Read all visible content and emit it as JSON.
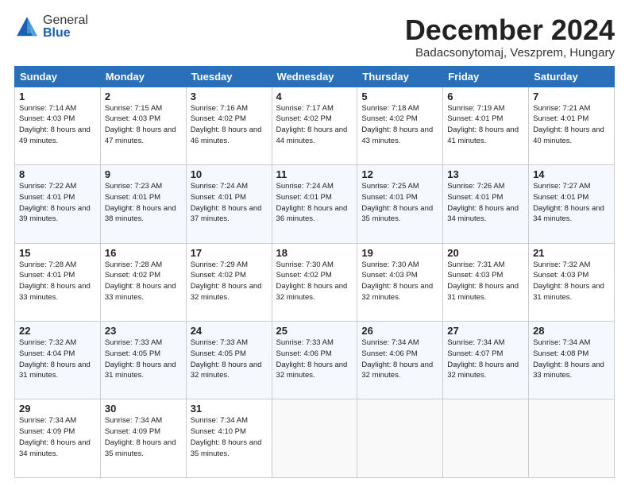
{
  "logo": {
    "general": "General",
    "blue": "Blue"
  },
  "title": "December 2024",
  "location": "Badacsonytomaj, Veszprem, Hungary",
  "days_of_week": [
    "Sunday",
    "Monday",
    "Tuesday",
    "Wednesday",
    "Thursday",
    "Friday",
    "Saturday"
  ],
  "weeks": [
    [
      {
        "day": 1,
        "sunrise": "7:14 AM",
        "sunset": "4:03 PM",
        "daylight": "8 hours and 49 minutes."
      },
      {
        "day": 2,
        "sunrise": "7:15 AM",
        "sunset": "4:03 PM",
        "daylight": "8 hours and 47 minutes."
      },
      {
        "day": 3,
        "sunrise": "7:16 AM",
        "sunset": "4:02 PM",
        "daylight": "8 hours and 46 minutes."
      },
      {
        "day": 4,
        "sunrise": "7:17 AM",
        "sunset": "4:02 PM",
        "daylight": "8 hours and 44 minutes."
      },
      {
        "day": 5,
        "sunrise": "7:18 AM",
        "sunset": "4:02 PM",
        "daylight": "8 hours and 43 minutes."
      },
      {
        "day": 6,
        "sunrise": "7:19 AM",
        "sunset": "4:01 PM",
        "daylight": "8 hours and 41 minutes."
      },
      {
        "day": 7,
        "sunrise": "7:21 AM",
        "sunset": "4:01 PM",
        "daylight": "8 hours and 40 minutes."
      }
    ],
    [
      {
        "day": 8,
        "sunrise": "7:22 AM",
        "sunset": "4:01 PM",
        "daylight": "8 hours and 39 minutes."
      },
      {
        "day": 9,
        "sunrise": "7:23 AM",
        "sunset": "4:01 PM",
        "daylight": "8 hours and 38 minutes."
      },
      {
        "day": 10,
        "sunrise": "7:24 AM",
        "sunset": "4:01 PM",
        "daylight": "8 hours and 37 minutes."
      },
      {
        "day": 11,
        "sunrise": "7:24 AM",
        "sunset": "4:01 PM",
        "daylight": "8 hours and 36 minutes."
      },
      {
        "day": 12,
        "sunrise": "7:25 AM",
        "sunset": "4:01 PM",
        "daylight": "8 hours and 35 minutes."
      },
      {
        "day": 13,
        "sunrise": "7:26 AM",
        "sunset": "4:01 PM",
        "daylight": "8 hours and 34 minutes."
      },
      {
        "day": 14,
        "sunrise": "7:27 AM",
        "sunset": "4:01 PM",
        "daylight": "8 hours and 34 minutes."
      }
    ],
    [
      {
        "day": 15,
        "sunrise": "7:28 AM",
        "sunset": "4:01 PM",
        "daylight": "8 hours and 33 minutes."
      },
      {
        "day": 16,
        "sunrise": "7:28 AM",
        "sunset": "4:02 PM",
        "daylight": "8 hours and 33 minutes."
      },
      {
        "day": 17,
        "sunrise": "7:29 AM",
        "sunset": "4:02 PM",
        "daylight": "8 hours and 32 minutes."
      },
      {
        "day": 18,
        "sunrise": "7:30 AM",
        "sunset": "4:02 PM",
        "daylight": "8 hours and 32 minutes."
      },
      {
        "day": 19,
        "sunrise": "7:30 AM",
        "sunset": "4:03 PM",
        "daylight": "8 hours and 32 minutes."
      },
      {
        "day": 20,
        "sunrise": "7:31 AM",
        "sunset": "4:03 PM",
        "daylight": "8 hours and 31 minutes."
      },
      {
        "day": 21,
        "sunrise": "7:32 AM",
        "sunset": "4:03 PM",
        "daylight": "8 hours and 31 minutes."
      }
    ],
    [
      {
        "day": 22,
        "sunrise": "7:32 AM",
        "sunset": "4:04 PM",
        "daylight": "8 hours and 31 minutes."
      },
      {
        "day": 23,
        "sunrise": "7:33 AM",
        "sunset": "4:05 PM",
        "daylight": "8 hours and 31 minutes."
      },
      {
        "day": 24,
        "sunrise": "7:33 AM",
        "sunset": "4:05 PM",
        "daylight": "8 hours and 32 minutes."
      },
      {
        "day": 25,
        "sunrise": "7:33 AM",
        "sunset": "4:06 PM",
        "daylight": "8 hours and 32 minutes."
      },
      {
        "day": 26,
        "sunrise": "7:34 AM",
        "sunset": "4:06 PM",
        "daylight": "8 hours and 32 minutes."
      },
      {
        "day": 27,
        "sunrise": "7:34 AM",
        "sunset": "4:07 PM",
        "daylight": "8 hours and 32 minutes."
      },
      {
        "day": 28,
        "sunrise": "7:34 AM",
        "sunset": "4:08 PM",
        "daylight": "8 hours and 33 minutes."
      }
    ],
    [
      {
        "day": 29,
        "sunrise": "7:34 AM",
        "sunset": "4:09 PM",
        "daylight": "8 hours and 34 minutes."
      },
      {
        "day": 30,
        "sunrise": "7:34 AM",
        "sunset": "4:09 PM",
        "daylight": "8 hours and 35 minutes."
      },
      {
        "day": 31,
        "sunrise": "7:34 AM",
        "sunset": "4:10 PM",
        "daylight": "8 hours and 35 minutes."
      },
      null,
      null,
      null,
      null
    ]
  ]
}
